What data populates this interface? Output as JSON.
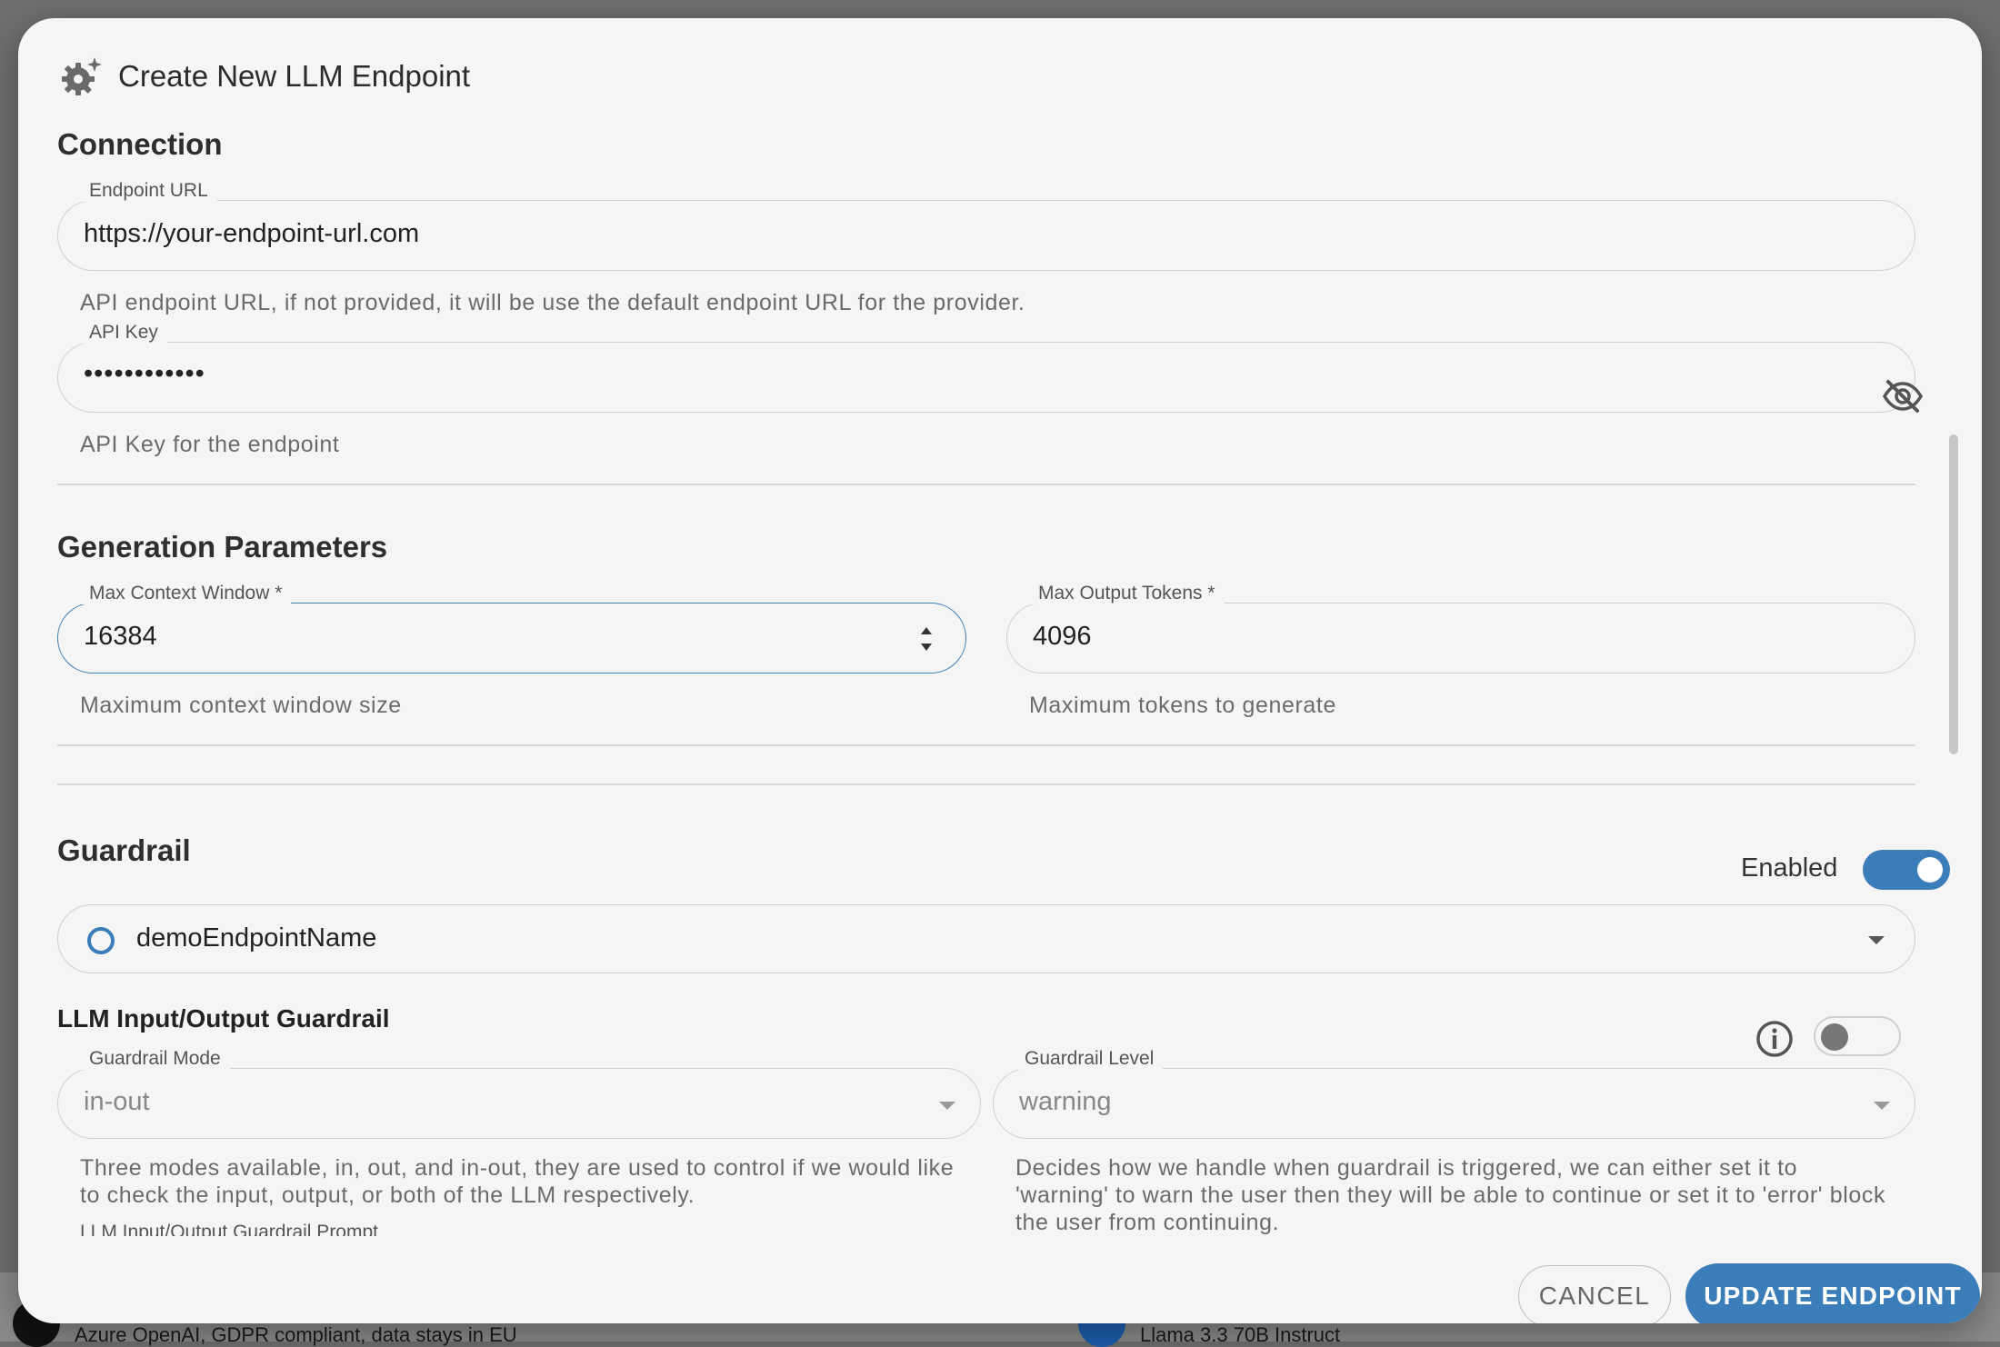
{
  "dialog": {
    "title": "Create New LLM Endpoint",
    "icon": "settings-sparkle-icon"
  },
  "connection": {
    "heading": "Connection",
    "endpoint_url": {
      "label": "Endpoint URL",
      "value": "https://your-endpoint-url.com",
      "helper": "API endpoint URL, if not provided, it will be use the default endpoint URL for the provider."
    },
    "api_key": {
      "label": "API Key",
      "value": "••••••••••••",
      "helper": "API Key for the endpoint",
      "visibility_icon": "eye-off-icon"
    }
  },
  "generation": {
    "heading": "Generation Parameters",
    "max_context": {
      "label": "Max Context Window *",
      "value": "16384",
      "helper": "Maximum context window size"
    },
    "max_output": {
      "label": "Max Output Tokens *",
      "value": "4096",
      "helper": "Maximum tokens to generate"
    }
  },
  "guardrail": {
    "heading": "Guardrail",
    "enabled_label": "Enabled",
    "enabled": true,
    "endpoint_select": "demoEndpointName",
    "io_heading": "LLM Input/Output Guardrail",
    "io_enabled": false,
    "mode": {
      "label": "Guardrail Mode",
      "value": "in-out",
      "helper": "Three modes available, in, out, and in-out, they are used to control if we would like to check the input, output, or both of the LLM respectively."
    },
    "level": {
      "label": "Guardrail Level",
      "value": "warning",
      "helper": "Decides how we handle when guardrail is triggered, we can either set it to 'warning' to warn the user then they will be able to continue or set it to 'error' block the user from continuing."
    },
    "prompt_label": "LLM Input/Output Guardrail Prompt"
  },
  "actions": {
    "cancel": "CANCEL",
    "update": "UPDATE ENDPOINT"
  },
  "background": {
    "left_item": "Azure OpenAI, GDPR compliant, data stays in EU",
    "right_item": "Llama 3.3 70B Instruct"
  },
  "colors": {
    "accent": "#3a7db8",
    "dialog_bg": "#f5f5f5",
    "scrim": "#6f6f6f"
  }
}
